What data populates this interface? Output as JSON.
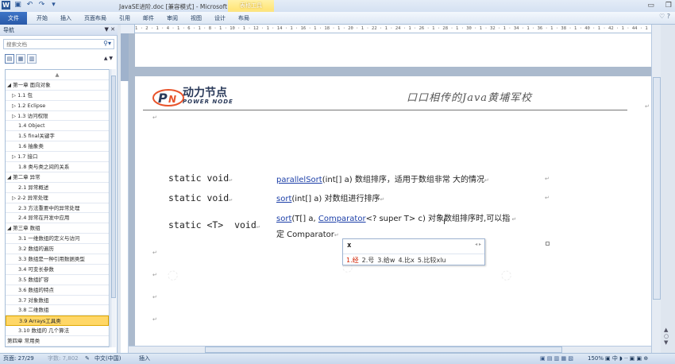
{
  "titlebar": {
    "title": "JavaSE进阶.doc [兼容模式] - Microsoft Word",
    "context_tab": "表格工具"
  },
  "ribbon": {
    "tabs": [
      "文件",
      "开始",
      "插入",
      "页面布局",
      "引用",
      "邮件",
      "审阅",
      "视图",
      "设计",
      "布局"
    ]
  },
  "nav": {
    "title": "导航",
    "search_placeholder": "搜索文档",
    "toc": [
      {
        "label": "▲",
        "level": "top"
      },
      {
        "label": "◢ 第一章 面向对象",
        "level": "l1"
      },
      {
        "label": "▷ 1.1 包",
        "level": "l2"
      },
      {
        "label": "▷ 1.2 Eclipse",
        "level": "l2"
      },
      {
        "label": "▷ 1.3 访问权限",
        "level": "l2"
      },
      {
        "label": "1.4 Object",
        "level": "l2s"
      },
      {
        "label": "1.5 final关键字",
        "level": "l2s"
      },
      {
        "label": "1.6 抽象类",
        "level": "l2s"
      },
      {
        "label": "▷ 1.7 接口",
        "level": "l2"
      },
      {
        "label": "1.8 类与类之间的关系",
        "level": "l2s"
      },
      {
        "label": "◢ 第二章 异常",
        "level": "l1"
      },
      {
        "label": "2.1 异常概述",
        "level": "l2s"
      },
      {
        "label": "▷ 2-2 异常处理",
        "level": "l2"
      },
      {
        "label": "2.3 方法重要中的异常处理",
        "level": "l2s"
      },
      {
        "label": "2.4 异常在开发中应用",
        "level": "l2s"
      },
      {
        "label": "◢ 第三章 数组",
        "level": "l1"
      },
      {
        "label": "3.1 一维数组的定义与访问",
        "level": "l2s"
      },
      {
        "label": "3.2 数组的遍历",
        "level": "l2s"
      },
      {
        "label": "3.3 数组是一种引用数据类型",
        "level": "l2s"
      },
      {
        "label": "3.4 可变长参数",
        "level": "l2s"
      },
      {
        "label": "3.5 数组扩容",
        "level": "l2s"
      },
      {
        "label": "3.6 数组的特点",
        "level": "l2s"
      },
      {
        "label": "3.7 对象数组",
        "level": "l2s"
      },
      {
        "label": "3.8 二维数组",
        "level": "l2s"
      },
      {
        "label": "3.9 Arrays工具类",
        "level": "l2s",
        "active": true
      },
      {
        "label": "3.10 数组的 几个算法",
        "level": "l2s"
      },
      {
        "label": "第四章 常用类",
        "level": "l1"
      }
    ]
  },
  "ruler_text": "1 · 2 · 1 · 4 · 1 · 6 · 1 · 8 · 1 · 10 · 1 · 12 · 1 · 14 · 1 · 16 · 1 · 18 · 1 · 20 · 1 · 22 · 1 · 24 · 1 · 26 · 1 · 28 · 1 · 30 · 1 · 32 · 1 · 34 · 1 · 36 · 1 · 38 · 1 · 40 · 1 · 42 · 1 · 44 · 1 · 46",
  "document": {
    "logo_cn": "动力节点",
    "logo_en": "POWER NODE",
    "slogan": "口口相传的Java黄埔军校",
    "rows": [
      {
        "mod": "static void",
        "method": "parallelSort",
        "params": "(int[] a)",
        "desc": " 数组排序，适用于数组非常 大的情况"
      },
      {
        "mod": "static void",
        "method": "sort",
        "params": "(int[] a)",
        "desc": " 对数组进行排序"
      },
      {
        "mod": "static <T>  void",
        "method": "sort",
        "params": "(T[] a, ",
        "link2": "Comparator",
        "params2": "<? super T> c)",
        "desc": " 对象数组排序时,可以指",
        "desc2": "定 Comparator"
      }
    ]
  },
  "ime": {
    "input": "x",
    "candidates": [
      "1.经",
      "2.号",
      "3.给w",
      "4.比x",
      "5.比较xlu"
    ]
  },
  "status": {
    "page": "页面: 27/29",
    "words": "字数: 7,802",
    "lang": "中文(中国)",
    "mode": "插入",
    "zoom": "150%"
  }
}
